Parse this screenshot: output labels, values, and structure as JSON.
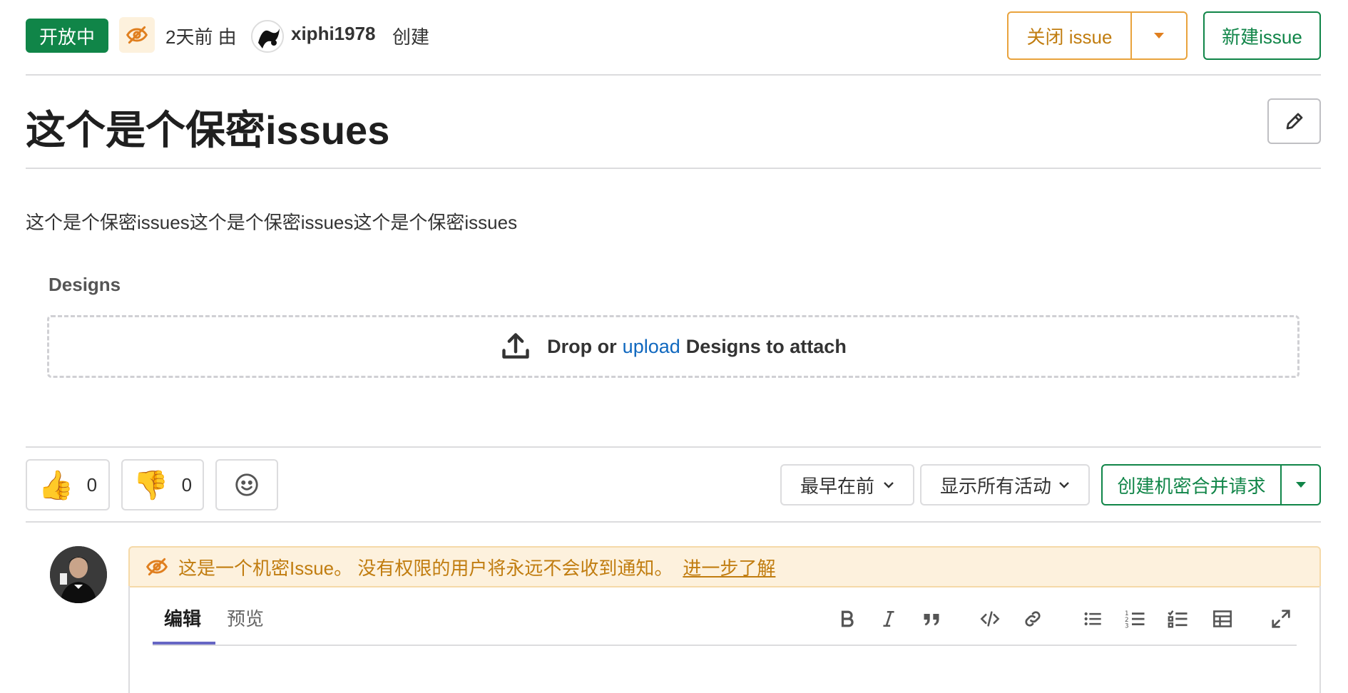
{
  "header": {
    "status_badge": "开放中",
    "time_ago": "2天前 由",
    "author": "xiphi1978",
    "created_suffix": "创建",
    "close_issue_label": "关闭 issue",
    "new_issue_label": "新建issue"
  },
  "issue": {
    "title": "这个是个保密issues",
    "description": "这个是个保密issues这个是个保密issues这个是个保密issues"
  },
  "designs": {
    "label": "Designs",
    "drop_prefix": "Drop or",
    "upload_link": "upload",
    "drop_suffix": "Designs to attach"
  },
  "reactions": {
    "thumbs_up_count": "0",
    "thumbs_down_count": "0"
  },
  "activity": {
    "sort_label": "最早在前",
    "filter_label": "显示所有活动",
    "create_mr_label": "创建机密合并请求"
  },
  "comment": {
    "confidential_notice": "这是一个机密Issue。 没有权限的用户将永远不会收到通知。",
    "learn_more": "进一步了解",
    "tab_edit": "编辑",
    "tab_preview": "预览"
  },
  "colors": {
    "open_badge": "#108548",
    "warning": "#c17d10",
    "warning_bg": "#fdf1dd",
    "link": "#1068bf"
  }
}
